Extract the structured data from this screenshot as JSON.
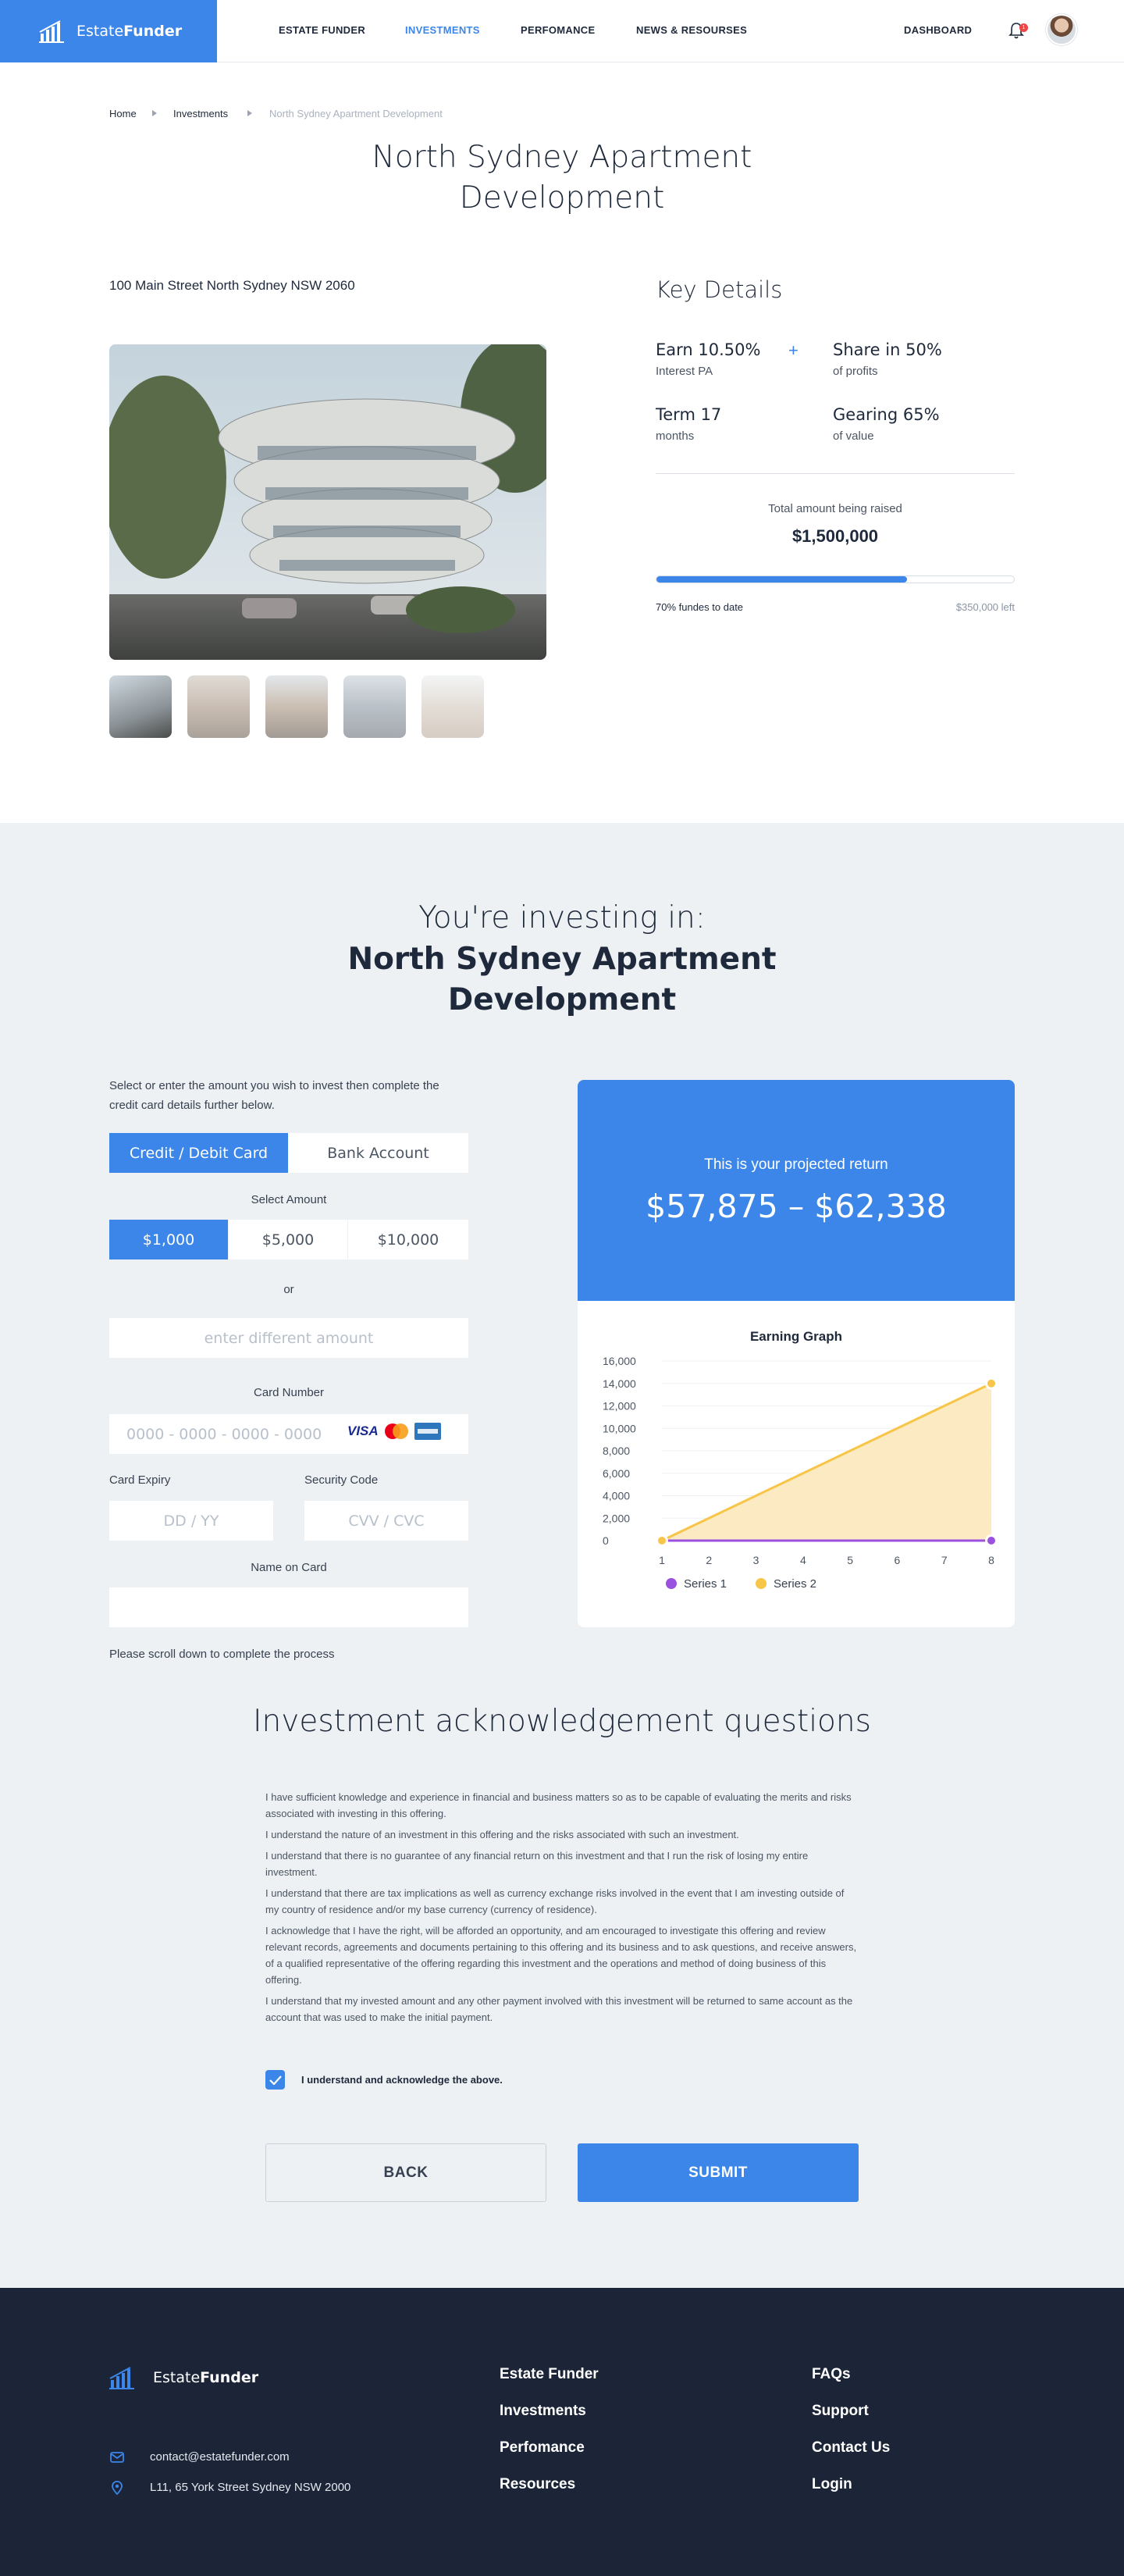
{
  "header": {
    "logo_prefix": "Estate",
    "logo_suffix": "Funder",
    "nav": [
      "ESTATE FUNDER",
      "INVESTMENTS",
      "PERFOMANCE",
      "NEWS & RESOURSES"
    ],
    "dashboard": "DASHBOARD",
    "notification_count": "1"
  },
  "breadcrumb": [
    "Home",
    "Investments",
    "North Sydney Apartment Development"
  ],
  "property": {
    "title": "North Sydney Apartment Development",
    "address": "100 Main Street North Sydney NSW 2060"
  },
  "key_details": {
    "heading": "Key Details",
    "earn_value": "Earn 10.50%",
    "earn_sub": "Interest PA",
    "share_value": "Share in 50%",
    "share_sub": "of profits",
    "term_value": "Term 17",
    "term_sub": "months",
    "gearing_value": "Gearing 65%",
    "gearing_sub": "of value",
    "plus": "+",
    "raised_label": "Total amount being raised",
    "raised_value": "$1,500,000",
    "progress_percent": 70,
    "funded_text": "70% fundes to date",
    "left_text": "$350,000 left"
  },
  "investing": {
    "heading_line1": "You're investing in:",
    "heading_line2": "North Sydney Apartment Development",
    "intro": "Select or enter the amount you wish to invest then complete the credit card details further below.",
    "tabs": [
      "Credit / Debit Card",
      "Bank Account"
    ],
    "select_amount_label": "Select Amount",
    "amounts": [
      "$1,000",
      "$5,000",
      "$10,000"
    ],
    "or": "or",
    "different_amount_placeholder": "enter different amount",
    "card_number_label": "Card Number",
    "card_number_placeholder": "0000 - 0000 - 0000 - 0000",
    "visa": "VISA",
    "expiry_label": "Card Expiry",
    "expiry_placeholder": "DD / YY",
    "security_label": "Security Code",
    "security_placeholder": "CVV / CVC",
    "name_label": "Name on Card",
    "scroll_note": "Please scroll down to complete the process"
  },
  "projection": {
    "label": "This is your projected return",
    "value": "$57,875 – $62,338",
    "graph_title": "Earning Graph"
  },
  "chart_data": {
    "type": "area",
    "title": "Earning Graph",
    "x": [
      1,
      2,
      3,
      4,
      5,
      6,
      7,
      8
    ],
    "ylim": [
      0,
      16000
    ],
    "yticks": [
      "16,000",
      "14,000",
      "12,000",
      "10,000",
      "8,000",
      "6,000",
      "4,000",
      "2,000",
      "0"
    ],
    "series": [
      {
        "name": "Series 1",
        "color": "#9b51e0",
        "values": [
          0,
          0,
          0,
          0,
          0,
          0,
          0,
          0
        ]
      },
      {
        "name": "Series 2",
        "color": "#f7c548",
        "values": [
          0,
          2000,
          4000,
          6000,
          8000,
          10000,
          12000,
          14000
        ]
      }
    ],
    "legend": "bottom",
    "grid": true
  },
  "acknowledgement": {
    "heading": "Investment acknowledgement questions",
    "items": [
      "I have sufficient knowledge and experience in financial and business matters so as to be capable of evaluating the merits and risks associated with investing in this offering.",
      "I understand the nature of an investment in this offering and the risks associated with such an investment.",
      "I understand that there is no guarantee of any financial return on this investment and that I run the risk of losing my entire investment.",
      "I understand that there are tax implications as well as currency exchange risks involved in the event that I am investing outside of my country of residence and/or my base currency (currency of residence).",
      "I acknowledge that I have the right, will be afforded an opportunity, and am encouraged to investigate this offering and review relevant records, agreements and documents pertaining to this offering and its business and to ask questions, and receive answers, of a qualified representative of the offering regarding this investment and the operations and method of doing business of this offering.",
      "I understand that my invested amount and any other payment involved with this investment will be returned to same account as the account that was used to make the initial payment."
    ],
    "checkbox_label": "I understand and acknowledge the above.",
    "checked": true,
    "back": "BACK",
    "submit": "SUBMIT"
  },
  "footer": {
    "logo_prefix": "Estate",
    "logo_suffix": "Funder",
    "email": "contact@estatefunder.com",
    "address": "L11, 65 York Street Sydney NSW 2000",
    "col1": [
      "Estate Funder",
      "Investments",
      "Perfomance",
      "Resources"
    ],
    "col2": [
      "FAQs",
      "Support",
      "Contact Us",
      "Login"
    ]
  },
  "colors": {
    "accent": "#3b86e8",
    "footer_bg": "#1c2538",
    "section_bg": "#eef1f3"
  }
}
